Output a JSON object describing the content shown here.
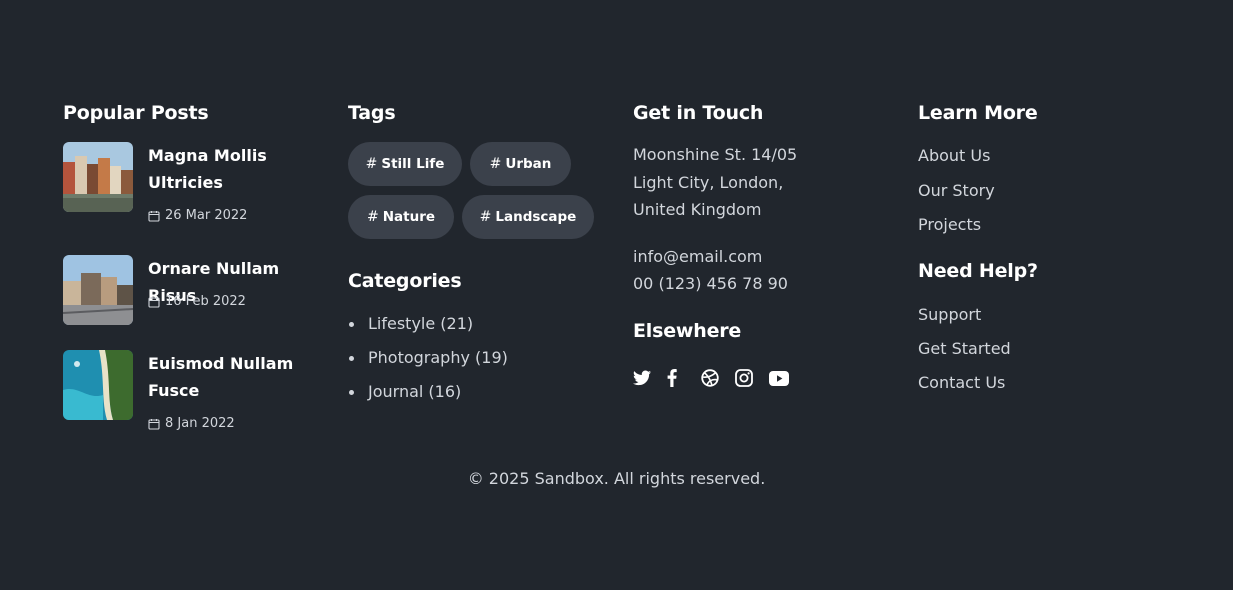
{
  "popular_posts": {
    "title": "Popular Posts",
    "items": [
      {
        "title": "Magna Mollis Ultricies",
        "date": "26 Mar 2022"
      },
      {
        "title": "Ornare Nullam Risus",
        "date": "16 Feb 2022"
      },
      {
        "title": "Euismod Nullam Fusce",
        "date": "8 Jan 2022"
      }
    ]
  },
  "tags": {
    "title": "Tags",
    "items": [
      "Still Life",
      "Urban",
      "Nature",
      "Landscape"
    ],
    "hash": "#"
  },
  "categories": {
    "title": "Categories",
    "items": [
      "Lifestyle (21)",
      "Photography (19)",
      "Journal (16)"
    ]
  },
  "contact": {
    "title": "Get in Touch",
    "address_lines": [
      "Moonshine St. 14/05",
      "Light City, London,",
      "United Kingdom"
    ],
    "email": "info@email.com",
    "phone": "00 (123) 456 78 90"
  },
  "elsewhere": {
    "title": "Elsewhere",
    "icons": [
      "twitter-icon",
      "facebook-icon",
      "dribbble-icon",
      "instagram-icon",
      "youtube-icon"
    ]
  },
  "learn_more": {
    "title": "Learn More",
    "links": [
      "About Us",
      "Our Story",
      "Projects"
    ]
  },
  "need_help": {
    "title": "Need Help?",
    "links": [
      "Support",
      "Get Started",
      "Contact Us"
    ]
  },
  "footer": {
    "copyright": "© 2025 Sandbox. All rights reserved."
  },
  "colors": {
    "background": "#21262d",
    "tag_background": "#3b414b",
    "heading": "#ffffff",
    "text": "#d2d6dc"
  }
}
